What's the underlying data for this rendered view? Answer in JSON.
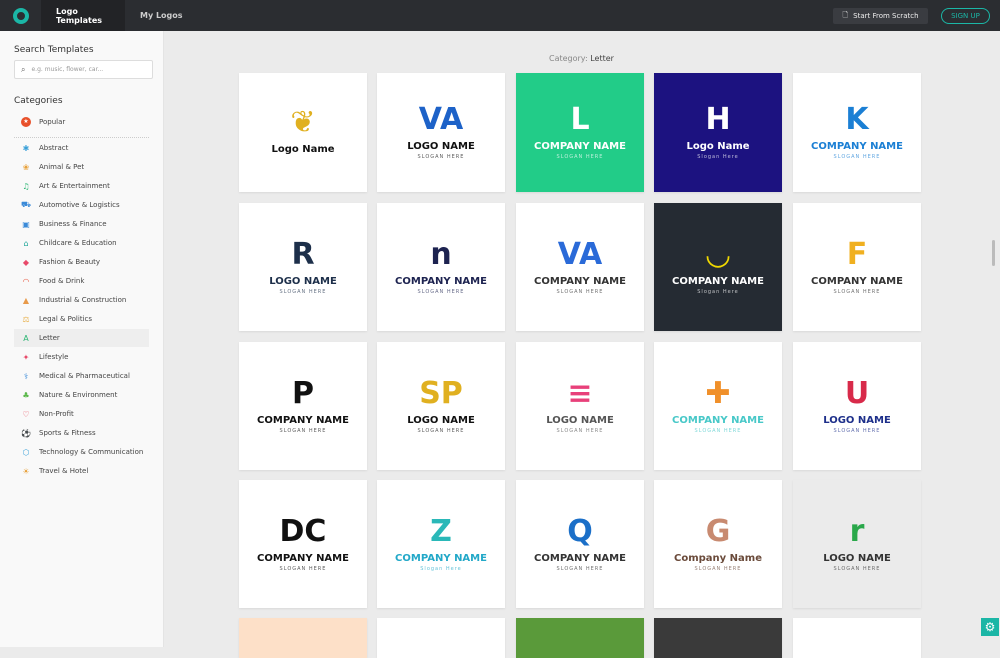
{
  "nav": {
    "tabs": [
      {
        "label": "Logo Templates"
      },
      {
        "label": "My Logos"
      }
    ],
    "start_scratch": "Start From Scratch",
    "signup": "SIGN UP",
    "accent": "#1bb6a6"
  },
  "sidebar": {
    "search_title": "Search Templates",
    "search_placeholder": "e.g. music, flower, car...",
    "categories_title": "Categories",
    "popular": "Popular",
    "categories": [
      {
        "label": "Abstract",
        "icon": "✱",
        "color": "#3aa0d8"
      },
      {
        "label": "Animal & Pet",
        "icon": "❀",
        "color": "#e8a13a"
      },
      {
        "label": "Art & Entertainment",
        "icon": "♫",
        "color": "#2bb673"
      },
      {
        "label": "Automotive & Logistics",
        "icon": "⛟",
        "color": "#3a8ad8"
      },
      {
        "label": "Business & Finance",
        "icon": "▣",
        "color": "#3a8ad8"
      },
      {
        "label": "Childcare & Education",
        "icon": "⌂",
        "color": "#22a89a"
      },
      {
        "label": "Fashion & Beauty",
        "icon": "◆",
        "color": "#e84a6a"
      },
      {
        "label": "Food & Drink",
        "icon": "◠",
        "color": "#e8604a"
      },
      {
        "label": "Industrial & Construction",
        "icon": "▲",
        "color": "#e89a4a"
      },
      {
        "label": "Legal & Politics",
        "icon": "⚖",
        "color": "#e8b04a"
      },
      {
        "label": "Letter",
        "icon": "A",
        "color": "#2bb673",
        "selected": true
      },
      {
        "label": "Lifestyle",
        "icon": "✦",
        "color": "#e84a6a"
      },
      {
        "label": "Medical & Pharmaceutical",
        "icon": "⚕",
        "color": "#3a8ad8"
      },
      {
        "label": "Nature & Environment",
        "icon": "♣",
        "color": "#5ab84a"
      },
      {
        "label": "Non-Profit",
        "icon": "♡",
        "color": "#e84a5a"
      },
      {
        "label": "Sports & Fitness",
        "icon": "⚽",
        "color": "#2a6ab8"
      },
      {
        "label": "Technology & Communication",
        "icon": "⬡",
        "color": "#3aa0d8"
      },
      {
        "label": "Travel & Hotel",
        "icon": "☀",
        "color": "#e8a13a"
      }
    ]
  },
  "main": {
    "category_label": "Category:",
    "category": "Letter",
    "cards": [
      {
        "glyph": "❦",
        "name": "Logo Name",
        "slogan": "",
        "bg": "#ffffff",
        "fg": "#111",
        "gc": "#e0b020"
      },
      {
        "glyph": "VA",
        "name": "LOGO NAME",
        "slogan": "SLOGAN HERE",
        "bg": "#ffffff",
        "fg": "#111",
        "gc": "#1d62c8"
      },
      {
        "glyph": "L",
        "name": "COMPANY NAME",
        "slogan": "SLOGAN HERE",
        "bg": "#22cc88",
        "fg": "#ffffff",
        "gc": "#ffffff"
      },
      {
        "glyph": "H",
        "name": "Logo Name",
        "slogan": "Slogan Here",
        "bg": "#1c1280",
        "fg": "#ffffff",
        "gc": "#ffffff"
      },
      {
        "glyph": "K",
        "name": "COMPANY NAME",
        "slogan": "SLOGAN HERE",
        "bg": "#ffffff",
        "fg": "#1b7fd4",
        "gc": "#1b7fd4"
      },
      {
        "glyph": "R",
        "name": "LOGO NAME",
        "slogan": "SLOGAN HERE",
        "bg": "#ffffff",
        "fg": "#1d2f4a",
        "gc": "#1d2f4a"
      },
      {
        "glyph": "n",
        "name": "COMPANY NAME",
        "slogan": "SLOGAN HERE",
        "bg": "#ffffff",
        "fg": "#1d2350",
        "gc": "#1d2350"
      },
      {
        "glyph": "VA",
        "name": "COMPANY NAME",
        "slogan": "SLOGAN HERE",
        "bg": "#ffffff",
        "fg": "#333",
        "gc": "#2a6ad8"
      },
      {
        "glyph": "◡",
        "name": "COMPANY NAME",
        "slogan": "Slogan Here",
        "bg": "#252b33",
        "fg": "#ffffff",
        "gc": "#f0d800"
      },
      {
        "glyph": "F",
        "name": "COMPANY NAME",
        "slogan": "SLOGAN HERE",
        "bg": "#ffffff",
        "fg": "#333",
        "gc": "#f0b020"
      },
      {
        "glyph": "P",
        "name": "COMPANY NAME",
        "slogan": "SLOGAN HERE",
        "bg": "#ffffff",
        "fg": "#111",
        "gc": "#111"
      },
      {
        "glyph": "SP",
        "name": "LOGO NAME",
        "slogan": "SLOGAN HERE",
        "bg": "#ffffff",
        "fg": "#111",
        "gc": "#e0b020"
      },
      {
        "glyph": "≡",
        "name": "LOGO NAME",
        "slogan": "SLOGAN HERE",
        "bg": "#ffffff",
        "fg": "#555",
        "gc": "#e8407a"
      },
      {
        "glyph": "✚",
        "name": "COMPANY NAME",
        "slogan": "SLOGAN HERE",
        "bg": "#ffffff",
        "fg": "#48c8c8",
        "gc": "#f0902a"
      },
      {
        "glyph": "U",
        "name": "LOGO NAME",
        "slogan": "SLOGAN HERE",
        "bg": "#ffffff",
        "fg": "#1d2f8a",
        "gc": "#d82a4a"
      },
      {
        "glyph": "DC",
        "name": "COMPANY NAME",
        "slogan": "SLOGAN HERE",
        "bg": "#ffffff",
        "fg": "#111",
        "gc": "#111"
      },
      {
        "glyph": "Z",
        "name": "COMPANY NAME",
        "slogan": "Slogan Here",
        "bg": "#ffffff",
        "fg": "#22a8c8",
        "gc": "#2ab8b8"
      },
      {
        "glyph": "Q",
        "name": "COMPANY NAME",
        "slogan": "SLOGAN HERE",
        "bg": "#ffffff",
        "fg": "#333",
        "gc": "#1b6fc8"
      },
      {
        "glyph": "G",
        "name": "Company Name",
        "slogan": "SLOGAN HERE",
        "bg": "#ffffff",
        "fg": "#6a4a3a",
        "gc": "#c88a70"
      },
      {
        "glyph": "r",
        "name": "LOGO NAME",
        "slogan": "SLOGAN HERE",
        "bg": "#ebebeb",
        "fg": "#333",
        "gc": "#2aa84a"
      },
      {
        "glyph": "",
        "name": "",
        "slogan": "",
        "bg": "#fde0c8",
        "fg": "#333",
        "gc": "#333"
      },
      {
        "glyph": "",
        "name": "",
        "slogan": "",
        "bg": "#ffffff",
        "fg": "#333",
        "gc": "#333"
      },
      {
        "glyph": "",
        "name": "",
        "slogan": "",
        "bg": "#5a9a3a",
        "fg": "#333",
        "gc": "#333"
      },
      {
        "glyph": "",
        "name": "",
        "slogan": "",
        "bg": "#3a3a3a",
        "fg": "#333",
        "gc": "#333"
      },
      {
        "glyph": "",
        "name": "",
        "slogan": "",
        "bg": "#ffffff",
        "fg": "#333",
        "gc": "#333"
      }
    ]
  }
}
